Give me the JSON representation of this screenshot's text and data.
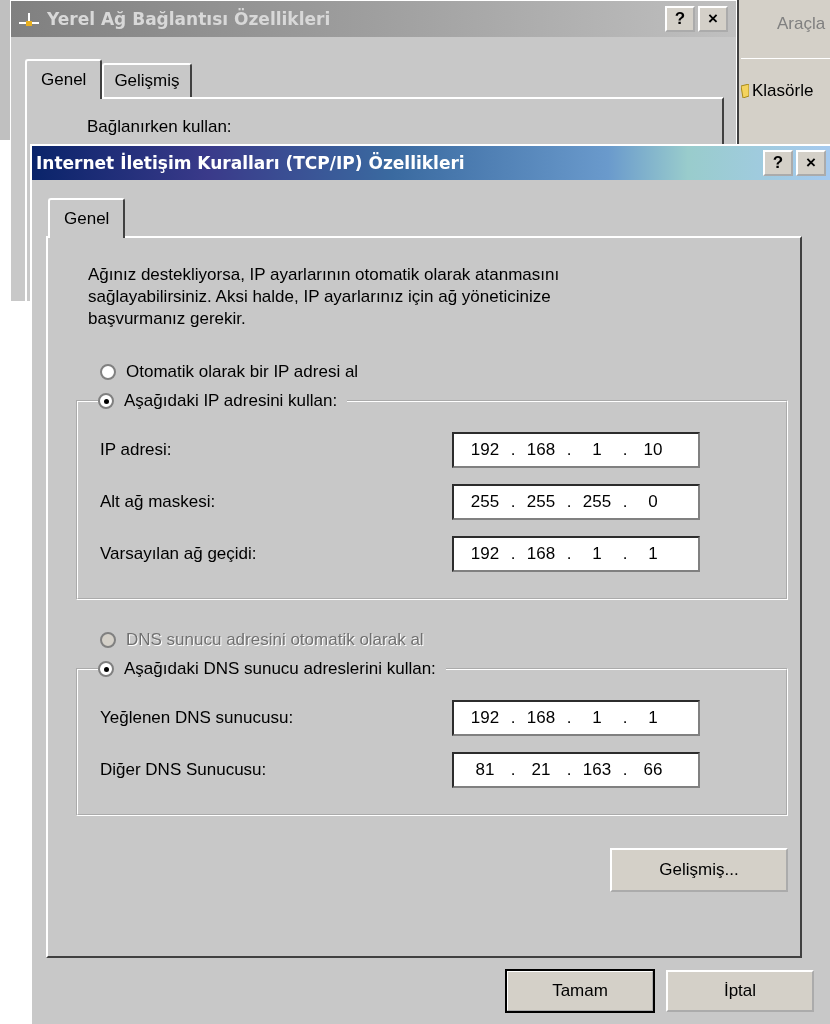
{
  "back_window": {
    "title": "Yerel Ağ Bağlantısı Özellikleri",
    "title_buttons": [
      "?",
      "×"
    ],
    "tabs": [
      {
        "label": "Genel",
        "selected": true
      },
      {
        "label": "Gelişmiş",
        "selected": false
      }
    ],
    "text": "Bağlanırken kullan:"
  },
  "side_window": {
    "menu_item": "Araçla",
    "toolbar_item": "Klasörle"
  },
  "dialog": {
    "title": "Internet İletişim Kuralları (TCP/IP) Özellikleri",
    "title_buttons": [
      "?",
      "×"
    ],
    "tabs": [
      {
        "label": "Genel",
        "selected": true
      }
    ],
    "description": "Ağınız destekliyorsa, IP ayarlarının otomatik olarak atanmasını sağlayabilirsiniz. Aksi halde, IP ayarlarınız için ağ yöneticinize başvurmanız gerekir.",
    "separator": ".",
    "sections": [
      {
        "auto_option": {
          "label": "Otomatik olarak bir IP adresi al",
          "selected": false,
          "disabled": false
        },
        "manual_option": {
          "label": "Aşağıdaki IP adresini kullan:",
          "selected": true,
          "disabled": false
        },
        "fields": [
          {
            "label": "IP adresi:",
            "octets": [
              "192",
              "168",
              "1",
              "10"
            ]
          },
          {
            "label": "Alt ağ maskesi:",
            "octets": [
              "255",
              "255",
              "255",
              "0"
            ]
          },
          {
            "label": "Varsayılan ağ geçidi:",
            "octets": [
              "192",
              "168",
              "1",
              "1"
            ]
          }
        ]
      },
      {
        "auto_option": {
          "label": "DNS sunucu adresini otomatik olarak al",
          "selected": false,
          "disabled": true
        },
        "manual_option": {
          "label": "Aşağıdaki DNS sunucu adreslerini kullan:",
          "selected": true,
          "disabled": false
        },
        "fields": [
          {
            "label": "Yeğlenen DNS sunucusu:",
            "octets": [
              "192",
              "168",
              "1",
              "1"
            ]
          },
          {
            "label": "Diğer DNS Sunucusu:",
            "octets": [
              "81",
              "21",
              "163",
              "66"
            ]
          }
        ]
      }
    ],
    "advanced_button": "Gelişmiş...",
    "buttons": [
      {
        "label": "Tamam",
        "default": true
      },
      {
        "label": "İptal",
        "default": false
      }
    ]
  }
}
